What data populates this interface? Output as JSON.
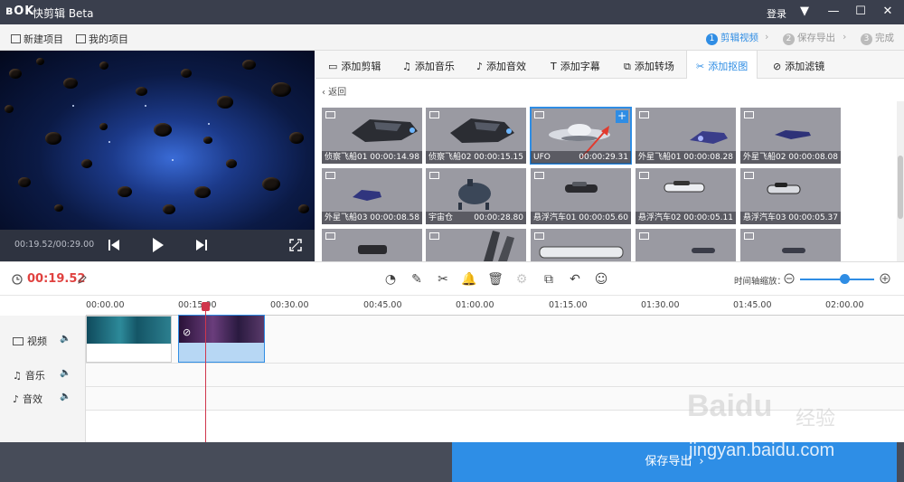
{
  "titlebar": {
    "logo": "ʙOK",
    "app_name": "快剪辑 Beta",
    "login": "登录",
    "menu_icon": "▼",
    "min_icon": "—",
    "max_icon": "☐",
    "close_icon": "✕"
  },
  "toolbar": {
    "new_project": "新建项目",
    "my_projects": "我的项目"
  },
  "steps": [
    {
      "num": "1",
      "label": "剪辑视频"
    },
    {
      "num": "2",
      "label": "保存导出"
    },
    {
      "num": "3",
      "label": "完成"
    }
  ],
  "player": {
    "time": "00:19.52/00:29.00"
  },
  "tabs": [
    {
      "icon": "▭",
      "label": "添加剪辑"
    },
    {
      "icon": "♫",
      "label": "添加音乐"
    },
    {
      "icon": "♪",
      "label": "添加音效"
    },
    {
      "icon": "T",
      "label": "添加字幕"
    },
    {
      "icon": "⧉",
      "label": "添加转场"
    },
    {
      "icon": "✂",
      "label": "添加抠图"
    },
    {
      "icon": "⊘",
      "label": "添加滤镜"
    }
  ],
  "back_label": "‹ 返回",
  "library": [
    {
      "name": "侦察飞船01",
      "duration": "00:00:14.98"
    },
    {
      "name": "侦察飞船02",
      "duration": "00:00:15.15"
    },
    {
      "name": "UFO",
      "duration": "00:00:29.31"
    },
    {
      "name": "外星飞船01",
      "duration": "00:00:08.28"
    },
    {
      "name": "外星飞船02",
      "duration": "00:00:08.08"
    },
    {
      "name": "外星飞船03",
      "duration": "00:00:08.58"
    },
    {
      "name": "宇宙仓",
      "duration": "00:00:28.80"
    },
    {
      "name": "悬浮汽车01",
      "duration": "00:00:05.60"
    },
    {
      "name": "悬浮汽车02",
      "duration": "00:00:05.11"
    },
    {
      "name": "悬浮汽车03",
      "duration": "00:00:05.37"
    }
  ],
  "timeline": {
    "current_time": "00:19.52",
    "zoom_label": "时间轴缩放：",
    "zoom_level": 0.55,
    "ruler": [
      "00:00.00",
      "00:15.00",
      "00:30.00",
      "00:45.00",
      "01:00.00",
      "01:15.00",
      "01:30.00",
      "01:45.00",
      "02:00.00"
    ],
    "tracks": [
      {
        "label": "视频"
      },
      {
        "label": "音乐"
      },
      {
        "label": "音效"
      }
    ]
  },
  "save_export": "保存导出",
  "watermark": {
    "logo": "Baidu",
    "logo_cn": "经验",
    "url": "jingyan.baidu.com"
  }
}
